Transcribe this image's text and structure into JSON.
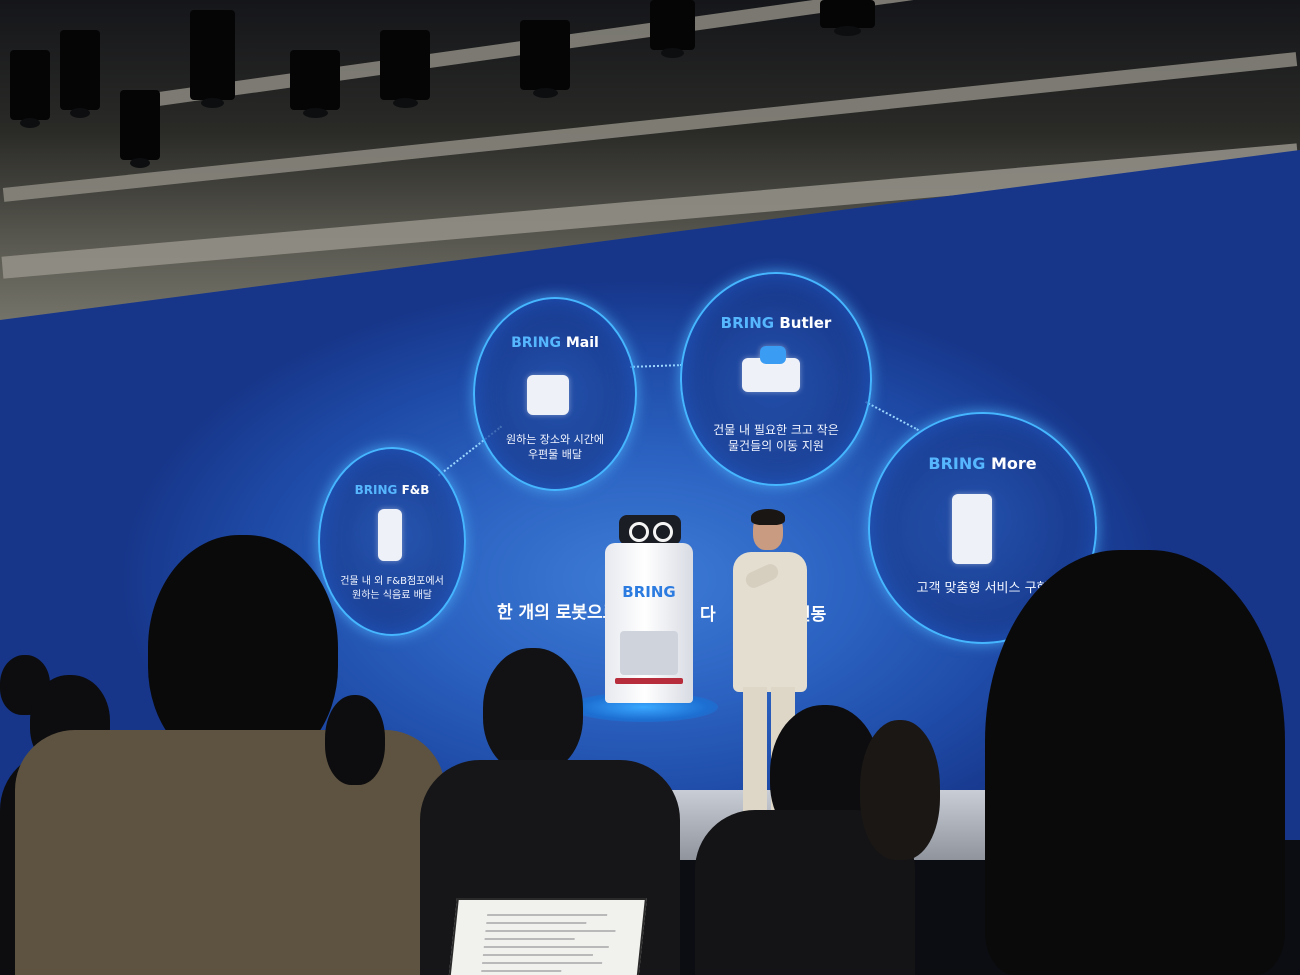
{
  "slide": {
    "brand_word": "BRING",
    "services": [
      {
        "name": "F&B",
        "desc": "건물 내 외 F&B점포에서\n원하는 식음료 배달"
      },
      {
        "name": "Mail",
        "desc": "원하는 장소와 시간에\n우편물 배달"
      },
      {
        "name": "Butler",
        "desc": "건물 내 필요한 크고 작은\n물건들의 이동 지원"
      },
      {
        "name": "More",
        "desc": "고객 맞춤형 서비스 구현"
      }
    ],
    "slogan_left": "한 개의 로봇으로",
    "slogan_right_start": "다",
    "slogan_right_end": "연동"
  },
  "robot": {
    "logo": "BRING"
  },
  "laptop_screen_lines": 8,
  "colors": {
    "screen_blue": "#2c63c2",
    "glow_ring": "#45b6ff",
    "brand_accent": "#56b7ff"
  }
}
